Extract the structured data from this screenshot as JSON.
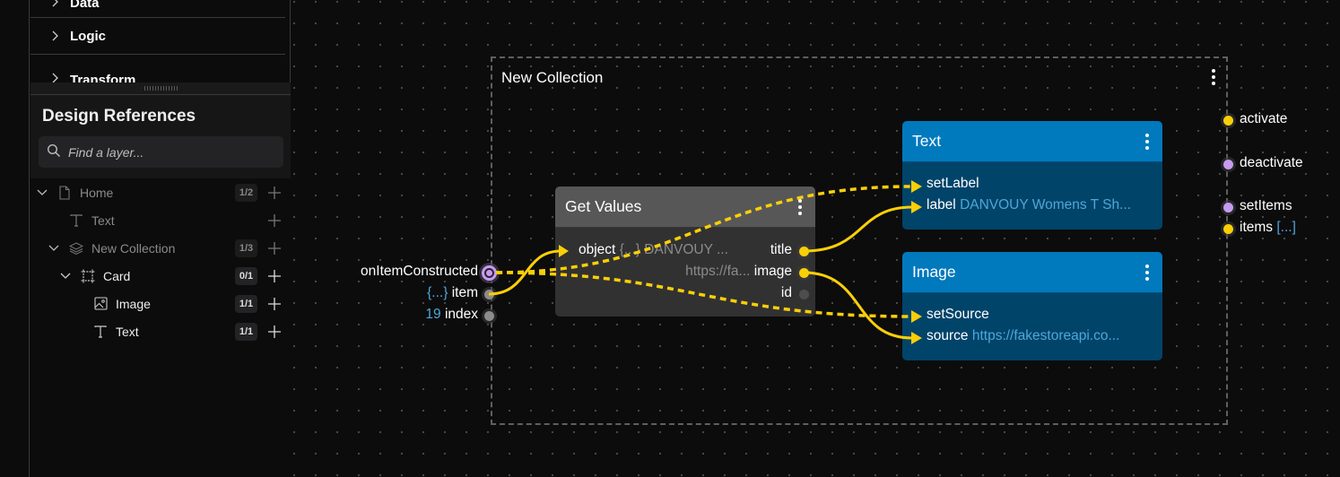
{
  "sidebar": {
    "categories": [
      {
        "label": "Data"
      },
      {
        "label": "Logic"
      },
      {
        "label": "Transform"
      }
    ],
    "refs_title": "Design References",
    "search": {
      "placeholder": "Find a layer..."
    },
    "tree": [
      {
        "label": "Home",
        "icon": "page-icon",
        "badge": "1/2",
        "expanded": true,
        "dim": true
      },
      {
        "label": "Text",
        "icon": "text-icon",
        "badge": null,
        "dim": true
      },
      {
        "label": "New Collection",
        "icon": "layers-icon",
        "badge": "1/3",
        "expanded": true,
        "dim": true
      },
      {
        "label": "Card",
        "icon": "frame-icon",
        "badge": "0/1",
        "expanded": true,
        "dim": false
      },
      {
        "label": "Image",
        "icon": "image-icon",
        "badge": "1/1",
        "dim": false
      },
      {
        "label": "Text",
        "icon": "text-icon",
        "badge": "1/1",
        "dim": false
      }
    ]
  },
  "canvas": {
    "collection": {
      "title": "New Collection",
      "inputs": [
        {
          "label": "onItemConstructed",
          "value": "",
          "color": "purple"
        },
        {
          "label": "item",
          "value": "{...}",
          "color": "gray"
        },
        {
          "label": "index",
          "value": "19",
          "color": "gray"
        }
      ],
      "outputs": [
        {
          "label": "activate",
          "value": "",
          "color": "yellow"
        },
        {
          "label": "deactivate",
          "value": "",
          "color": "purple"
        },
        {
          "label": "setItems",
          "value": "",
          "color": "purple"
        },
        {
          "label": "items",
          "value": "[...]",
          "color": "yellow"
        }
      ]
    },
    "get_values": {
      "title": "Get Values",
      "input": {
        "label": "object",
        "value": "{...}",
        "preview": "DANVOUY ..."
      },
      "outputs": [
        {
          "label": "title",
          "preview": ""
        },
        {
          "label": "image",
          "preview": "https://fa..."
        },
        {
          "label": "id",
          "preview": ""
        }
      ]
    },
    "text_node": {
      "title": "Text",
      "ports": [
        {
          "label": "setLabel",
          "value": ""
        },
        {
          "label": "label",
          "value": "DANVOUY Womens T Sh..."
        }
      ]
    },
    "image_node": {
      "title": "Image",
      "ports": [
        {
          "label": "setSource",
          "value": ""
        },
        {
          "label": "source",
          "value": "https://fakestoreapi.co..."
        }
      ]
    }
  },
  "colors": {
    "accent_yellow": "#fbcf07",
    "signal_purple": "#c79bef",
    "node_blue": "#0179bd",
    "node_blue_body": "#01446a",
    "value_blue": "#4fa6d8"
  }
}
